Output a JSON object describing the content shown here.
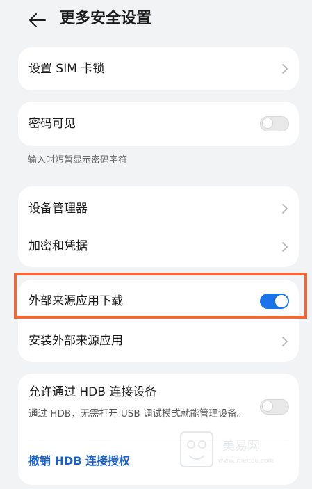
{
  "header": {
    "title": "更多安全设置",
    "back_icon": "arrow-left-icon"
  },
  "sim_lock": {
    "label": "设置 SIM 卡锁"
  },
  "password_visible": {
    "label": "密码可见",
    "enabled": false,
    "description": "输入时短暂显示密码字符"
  },
  "device_group": {
    "device_manager": "设备管理器",
    "encryption": "加密和凭据"
  },
  "external_group": {
    "external_download": {
      "label": "外部来源应用下载",
      "enabled": true
    },
    "install_external": "安装外部来源应用"
  },
  "hdb": {
    "label": "允许通过 HDB 连接设备",
    "description": "通过 HDB，无需打开 USB 调试模式就能管理设备。",
    "enabled": false,
    "revoke_label": "撤销 HDB 连接授权"
  },
  "colors": {
    "accent": "#1a73e8",
    "highlight": "#ef6a3a",
    "link": "#1a5fc4"
  },
  "watermark": {
    "name": "美易网",
    "url": "www.imeitou.com"
  }
}
